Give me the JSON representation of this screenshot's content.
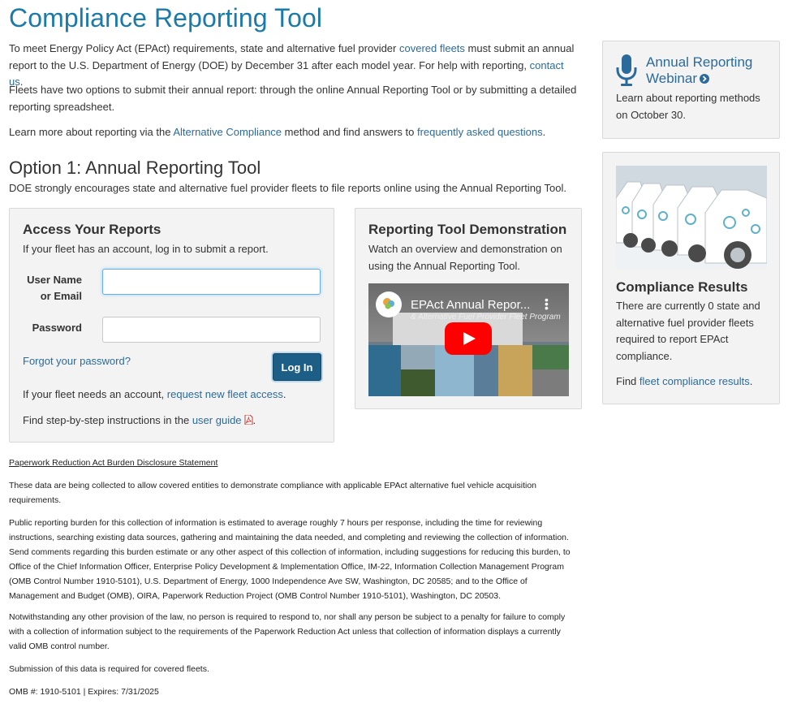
{
  "page_title": "Compliance Reporting Tool",
  "intro": {
    "p1_a": "To meet Energy Policy Act (EPAct) requirements, state and alternative fuel provider ",
    "p1_link1": "covered fleets",
    "p1_b": " must submit an annual report to the U.S. Department of Energy (DOE) by December 31 after each model year. For help with reporting, ",
    "p1_link2": "contact us",
    "p1_c": ".",
    "p2": "Fleets have two options to submit their annual report: through the online Annual Reporting Tool or by submitting a detailed reporting spreadsheet.",
    "p3_a": "Learn more about reporting via the ",
    "p3_link1": "Alternative Compliance",
    "p3_b": " method and find answers to ",
    "p3_link2": "frequently asked questions",
    "p3_c": "."
  },
  "option1": {
    "heading": "Option 1: Annual Reporting Tool",
    "desc": "DOE strongly encourages state and alternative fuel provider fleets to file reports online using the Annual Reporting Tool."
  },
  "access": {
    "heading": "Access Your Reports",
    "desc": "If your fleet has an account, log in to submit a report.",
    "username_label_1": "User Name",
    "username_label_2": "or Email",
    "username_value": "",
    "password_label": "Password",
    "password_value": "",
    "forgot": "Forgot your password?",
    "login_button": "Log In",
    "need_a": "If your fleet needs an account, ",
    "need_link": "request new fleet access",
    "need_b": ".",
    "guide_a": "Find step-by-step instructions in the ",
    "guide_link": "user guide",
    "guide_b": "."
  },
  "demo": {
    "heading": "Reporting Tool Demonstration",
    "desc": "Watch an overview and demonstration on using the Annual Reporting Tool.",
    "video_title": "EPAct Annual Repor...",
    "video_subtitle": "& Alternative Fuel Provider Fleet Program"
  },
  "webinar": {
    "title": "Annual Reporting Webinar",
    "desc": "Learn about reporting methods on October 30."
  },
  "results": {
    "heading": "Compliance Results",
    "desc": "There are currently 0 state and alternative fuel provider fleets required to report EPAct compliance.",
    "find_a": "Find ",
    "find_link": "fleet compliance results",
    "find_b": "."
  },
  "disclosure": {
    "heading": "Paperwork Reduction Act Burden Disclosure Statement",
    "p1": "These data are being collected to allow covered entities to demonstrate compliance with applicable EPAct alternative fuel vehicle acquisition requirements.",
    "p2": "Public reporting burden for this collection of information is estimated to average roughly 7 hours per response, including the time for reviewing instructions, searching existing data sources, gathering and maintaining the data needed, and completing and reviewing the collection of information. Send comments regarding this burden estimate or any other aspect of this collection of information, including suggestions for reducing this burden, to Office of the Chief Information Officer, Enterprise Policy Development & Implementation Office, IM-22, Information Collection Management Program (OMB Control Number 1910-5101), U.S. Department of Energy, 1000 Independence Ave SW, Washington, DC 20585; and to the Office of Management and Budget (OMB), OIRA, Paperwork Reduction Project (OMB Control Number 1910-5101), Washington, DC 20503.",
    "p3": "Notwithstanding any other provision of the law, no person is required to respond to, nor shall any person be subject to a penalty for failure to comply with a collection of information subject to the requirements of the Paperwork Reduction Act unless that collection of information displays a currently valid OMB control number.",
    "p4": "Submission of this data is required for covered fleets.",
    "omb": "OMB #: 1910-5101 | Expires: 7/31/2025"
  },
  "colors": {
    "title": "#1a7aa8",
    "link": "#2b6b9b",
    "button": "#1c5e85",
    "panel": "#f3f3f3",
    "play": "#ff0000"
  },
  "icons": [
    "microphone-icon",
    "circle-arrow-icon",
    "pdf-icon",
    "youtube-play-icon",
    "more-options-icon"
  ]
}
